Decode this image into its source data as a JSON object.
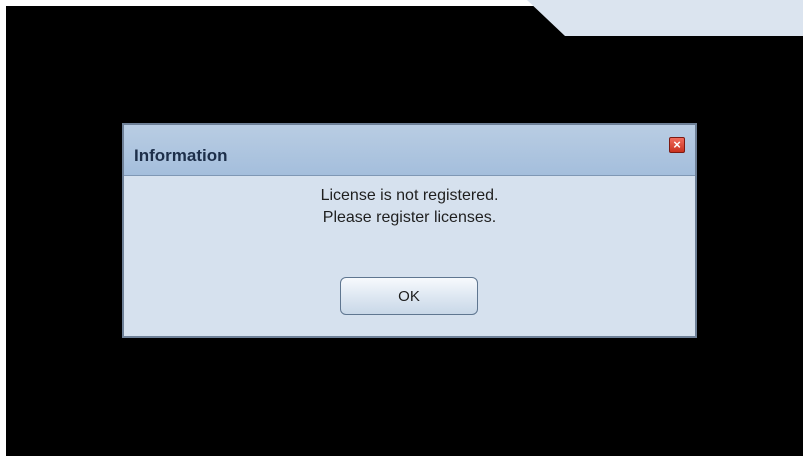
{
  "dialog": {
    "title": "Information",
    "close_icon": "close-icon",
    "message_line_1": "License is not registered.",
    "message_line_2": "Please register licenses.",
    "ok_label": "OK"
  },
  "colors": {
    "backdrop": "#000000",
    "dialog_background": "#d6e1ee",
    "titlebar": "#b9cde3",
    "close_button": "#d9412f",
    "corner_panel": "#dbe4ef"
  }
}
